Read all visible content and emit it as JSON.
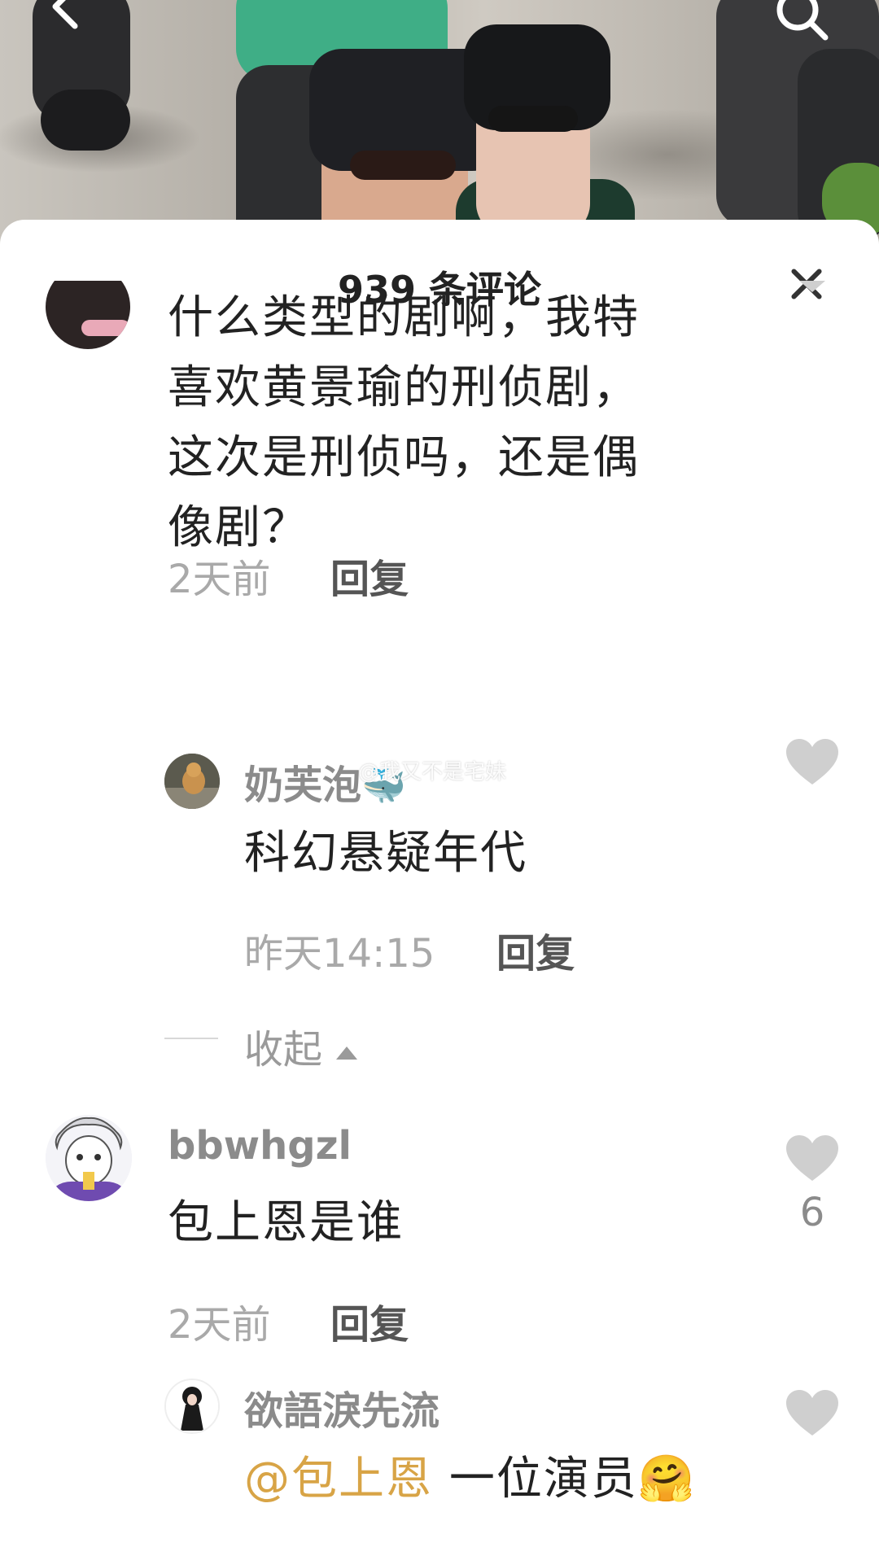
{
  "header": {
    "back_icon": "chevron-left-icon",
    "search_icon": "search-icon"
  },
  "sheet": {
    "title": "939 条评论",
    "close_icon": "close-icon"
  },
  "comments": [
    {
      "avatar": "avatar-partial",
      "text": "什么类型的剧啊，我特喜欢黄景瑜的刑侦剧，这次是刑侦吗，还是偶像剧？",
      "lines": [
        "什么类型的剧啊，我特",
        "喜欢黄景瑜的刑侦剧，",
        "这次是刑侦吗，还是偶",
        "像剧？"
      ],
      "time": "2天前",
      "reply_label": "回复",
      "replies": [
        {
          "username": "奶芙泡",
          "username_emoji": "🐳",
          "watermark": "@我又不是宅妹",
          "text": "科幻悬疑年代",
          "time": "昨天14:15",
          "reply_label": "回复"
        }
      ],
      "collapse_label": "收起"
    },
    {
      "username": "bbwhgzl",
      "text": "包上恩是谁",
      "time": "2天前",
      "reply_label": "回复",
      "likes": "6",
      "replies": [
        {
          "username": "欲語淚先流",
          "mention": "@包上恩",
          "text": "一位演员",
          "emoji": "🤗"
        }
      ]
    }
  ],
  "colors": {
    "mention": "#d8a446",
    "heart": "#cfcfcf"
  }
}
